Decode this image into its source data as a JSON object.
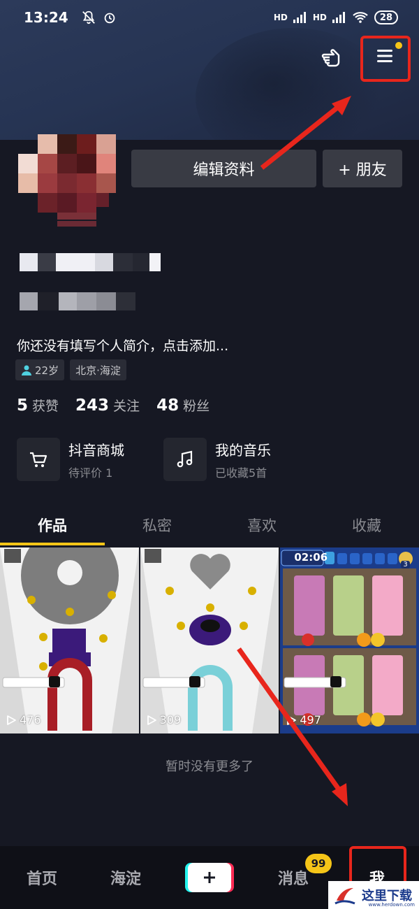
{
  "status_bar": {
    "time": "13:24",
    "network_1": "HD",
    "network_2": "HD",
    "battery": "28"
  },
  "profile": {
    "edit_button": "编辑资料",
    "add_friend_button": "+ 朋友",
    "bio": "你还没有填写个人简介，点击添加...",
    "tags": [
      {
        "label": "22岁",
        "icon": "person-icon"
      },
      {
        "label": "北京·海淀"
      }
    ]
  },
  "stats": [
    {
      "value": "5",
      "label": "获赞"
    },
    {
      "value": "243",
      "label": "关注"
    },
    {
      "value": "48",
      "label": "粉丝"
    }
  ],
  "services": [
    {
      "title": "抖音商城",
      "subtitle": "待评价 1",
      "icon": "cart-icon"
    },
    {
      "title": "我的音乐",
      "subtitle": "已收藏5首",
      "icon": "music-note-icon"
    }
  ],
  "tabs": [
    "作品",
    "私密",
    "喜欢",
    "收藏"
  ],
  "videos": [
    {
      "views": "476"
    },
    {
      "views": "309"
    },
    {
      "views": "497",
      "timer": "02:06",
      "hint_count": "3"
    }
  ],
  "no_more_text": "暂时没有更多了",
  "bottom_nav": {
    "home": "首页",
    "local": "海淀",
    "messages": "消息",
    "messages_badge": "99",
    "me": "我"
  },
  "watermark": {
    "text": "这里下载",
    "url": "www.herdown.com"
  },
  "colors": {
    "accent": "#f5c518",
    "annotation": "#e8261c",
    "background": "#161823"
  }
}
